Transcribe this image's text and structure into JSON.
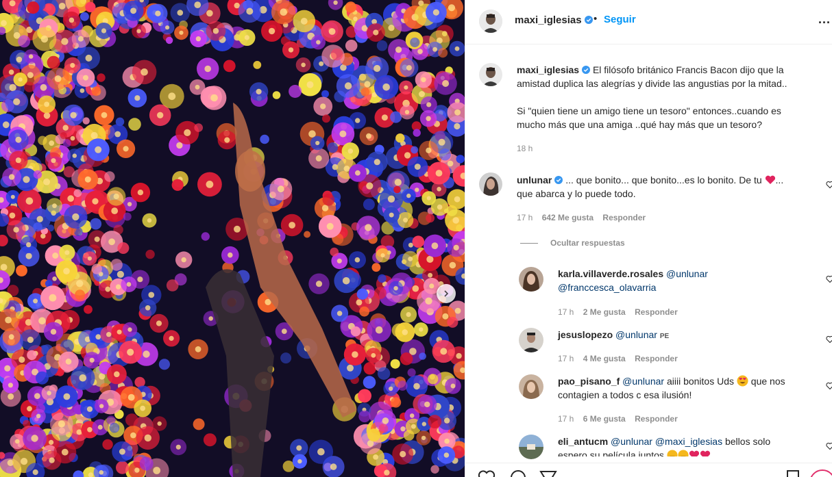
{
  "post": {
    "username": "maxi_iglesias",
    "separator": "•",
    "follow_label": "Seguir",
    "more_label": "..."
  },
  "caption": {
    "username": "maxi_iglesias",
    "paragraph1_line1": "El filósofo británico Francis Bacon dijo que la",
    "paragraph1_line2": "amistad duplica las alegrías y divide las angustias por la mitad..",
    "paragraph2_line1": "Si \"quien tiene un amigo tiene un tesoro\" entonces..cuando es",
    "paragraph2_line2": "mucho más que una amiga ..qué hay más que un tesoro?",
    "time": "18 h"
  },
  "comment": {
    "username": "unlunar",
    "text_line1": "... que bonito... que bonito...es lo bonito. De tu",
    "text_line1_after": "...",
    "text_line2": "que abarca y lo puede todo.",
    "time": "17 h",
    "likes": "642 Me gusta",
    "reply": "Responder",
    "hide_replies": "Ocultar respuestas"
  },
  "replies": [
    {
      "username": "karla.villaverde.rosales",
      "mention1": "@unlunar",
      "mention2": "@franccesca_olavarria",
      "time": "17 h",
      "likes": "2 Me gusta",
      "reply": "Responder"
    },
    {
      "username": "jesuslopezo",
      "mention": "@unlunar",
      "flag": "PE",
      "time": "17 h",
      "likes": "4 Me gusta",
      "reply": "Responder"
    },
    {
      "username": "pao_pisano_f",
      "mention": "@unlunar",
      "text_a": "aiiii bonitos Uds",
      "text_b": "que nos",
      "text_line2": "contagien a todos c esa ilusión!",
      "time": "17 h",
      "likes": "6 Me gusta",
      "reply": "Responder"
    },
    {
      "username": "eli_antucm",
      "mention1": "@unlunar",
      "mention2": "@maxi_iglesias",
      "text_a": "bellos solo",
      "text_line2": "espero su película juntos"
    }
  ],
  "icons": {
    "verified": "verified-badge-icon",
    "like": "heart-icon",
    "comment": "comment-icon",
    "share": "paper-plane-icon",
    "save": "bookmark-icon",
    "next": "chevron-right-icon"
  },
  "colors": {
    "link": "#0095f6",
    "mention": "#00376b",
    "muted": "#8e8e8e",
    "heart": "#ed4956"
  }
}
